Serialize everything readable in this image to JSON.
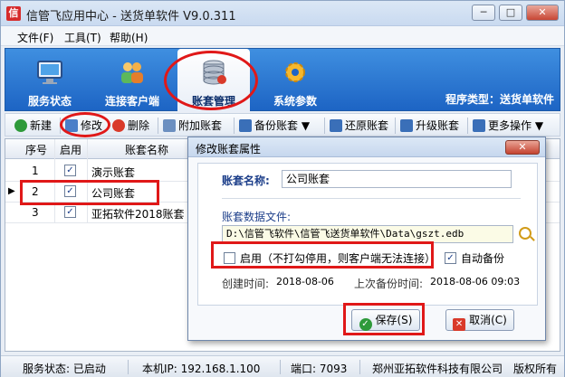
{
  "window": {
    "title": "信管飞应用中心 - 送货单软件 V9.0.311",
    "app_icon_glyph": "信",
    "controls": [
      "─",
      "□",
      "✕"
    ]
  },
  "menu": [
    "文件(F)",
    "工具(T)",
    "帮助(H)"
  ],
  "ribbon": {
    "tabs": [
      {
        "label": "服务状态",
        "icon": "monitor-icon"
      },
      {
        "label": "连接客户端",
        "icon": "users-icon"
      },
      {
        "label": "账套管理",
        "icon": "database-icon",
        "active": true
      },
      {
        "label": "系统参数",
        "icon": "gear-icon"
      }
    ],
    "program_type": "程序类型：送货单软件"
  },
  "toolbar": {
    "items": [
      {
        "label": "新建",
        "icon": "add-icon",
        "color": "#2e9a3a"
      },
      {
        "label": "修改",
        "icon": "edit-icon",
        "color": "#4a7fc8"
      },
      {
        "label": "删除",
        "icon": "delete-icon",
        "color": "#d93a2a"
      },
      {
        "label": "附加账套",
        "icon": "attach-icon",
        "color": "#6b8fc0"
      },
      {
        "label": "备份账套 ▼",
        "icon": "backup-icon",
        "color": "#3a6fb8"
      },
      {
        "label": "还原账套",
        "icon": "restore-icon",
        "color": "#3a6fb8"
      },
      {
        "label": "升级账套",
        "icon": "upgrade-icon",
        "color": "#3a6fb8"
      },
      {
        "label": "更多操作 ▼",
        "icon": "more-icon",
        "color": "#3a6fb8"
      }
    ]
  },
  "grid": {
    "columns": [
      "序号",
      "启用",
      "账套名称"
    ],
    "rows": [
      {
        "no": "1",
        "enabled": "✓",
        "name": "演示账套"
      },
      {
        "no": "2",
        "enabled": "✓",
        "name": "公司账套",
        "selected": true
      },
      {
        "no": "3",
        "enabled": "✓",
        "name": "亚拓软件2018账套"
      }
    ]
  },
  "dialog": {
    "title": "修改账套属性",
    "close": "✕",
    "name_label": "账套名称:",
    "name_value": "公司账套",
    "file_label": "账套数据文件:",
    "file_value": "D:\\信管飞软件\\信管飞送货单软件\\Data\\gszt.edb",
    "enable_label": "启用（不打勾停用，则客户端无法连接）",
    "enable_checked": "",
    "auto_backup_label": "自动备份",
    "auto_backup_checked": "✓",
    "created_label": "创建时间:",
    "created_value": "2018-08-06",
    "backup_label": "上次备份时间:",
    "backup_value": "2018-08-06 09:03",
    "save_label": "保存(S)",
    "cancel_label": "取消(C)"
  },
  "status": {
    "service": "服务状态: 已启动",
    "ip": "本机IP: 192.168.1.100",
    "port": "端口: 7093",
    "company": "郑州亚拓软件科技有限公司",
    "copyright": "版权所有"
  }
}
